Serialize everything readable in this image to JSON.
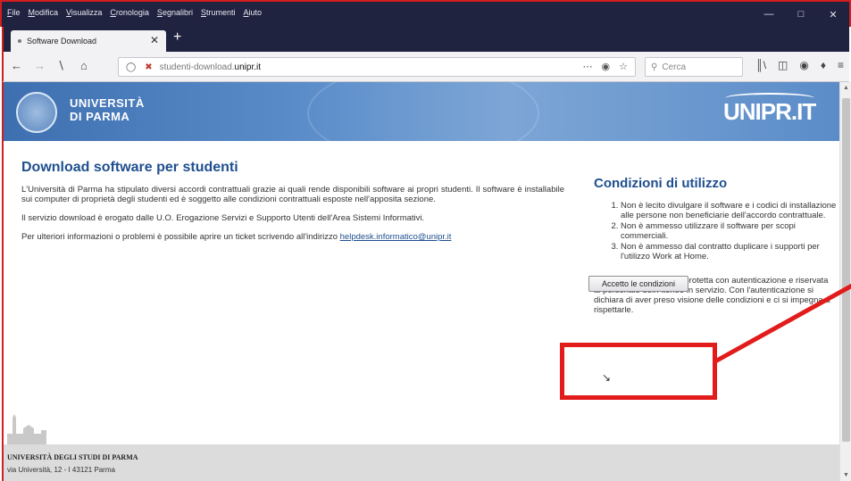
{
  "browser": {
    "menu": [
      "File",
      "Modifica",
      "Visualizza",
      "Cronologia",
      "Segnalibri",
      "Strumenti",
      "Aiuto"
    ],
    "tab_title": "Software Download",
    "url_prefix": "studenti-download.",
    "url_domain": "unipr.it",
    "search_placeholder": "Cerca"
  },
  "banner": {
    "university_line1": "UNIVERSITÀ",
    "university_line2": "DI PARMA",
    "logo_text": "UNIPR.IT"
  },
  "main": {
    "title": "Download software per studenti",
    "para1": "L'Università di Parma ha stipulato diversi accordi contrattuali grazie ai quali rende disponibili software ai propri studenti. Il software è installabile sui computer di proprietà degli studenti ed è soggetto alle condizioni contrattuali esposte nell'apposita sezione.",
    "para2": "Il servizio download è erogato dalle U.O. Erogazione Servizi e Supporto Utenti dell'Area Sistemi Informativi.",
    "para3_prefix": "Per ulteriori informazioni o problemi è possibile aprire un ticket scrivendo all'indirizzo ",
    "helpdesk_email": "helpdesk.informatico@unipr.it"
  },
  "conditions": {
    "title": "Condizioni di utilizzo",
    "items": [
      "Non è lecito divulgare il software e i codici di installazione alle persone non beneficiarie dell'accordo contrattuale.",
      "Non è ammesso utilizzare il software per scopi commerciali.",
      "Non è ammesso dal contratto duplicare i supporti per l'utilizzo Work at Home."
    ],
    "notice": "La pagina successiva è protetta con autenticazione e riservata al personale dell'Ateneo in servizio. Con l'autenticazione si dichiara di aver preso visione delle condizioni e ci si impegna a rispettarle.",
    "accept_button": "Accetto le condizioni"
  },
  "footer": {
    "institution": "UNIVERSITÀ DEGLI STUDI DI PARMA",
    "address": "via Università, 12 - I 43121 Parma"
  },
  "colors": {
    "heading_blue": "#1f4f8f",
    "annotation_red": "#e21b1b",
    "titlebar": "#202340"
  }
}
